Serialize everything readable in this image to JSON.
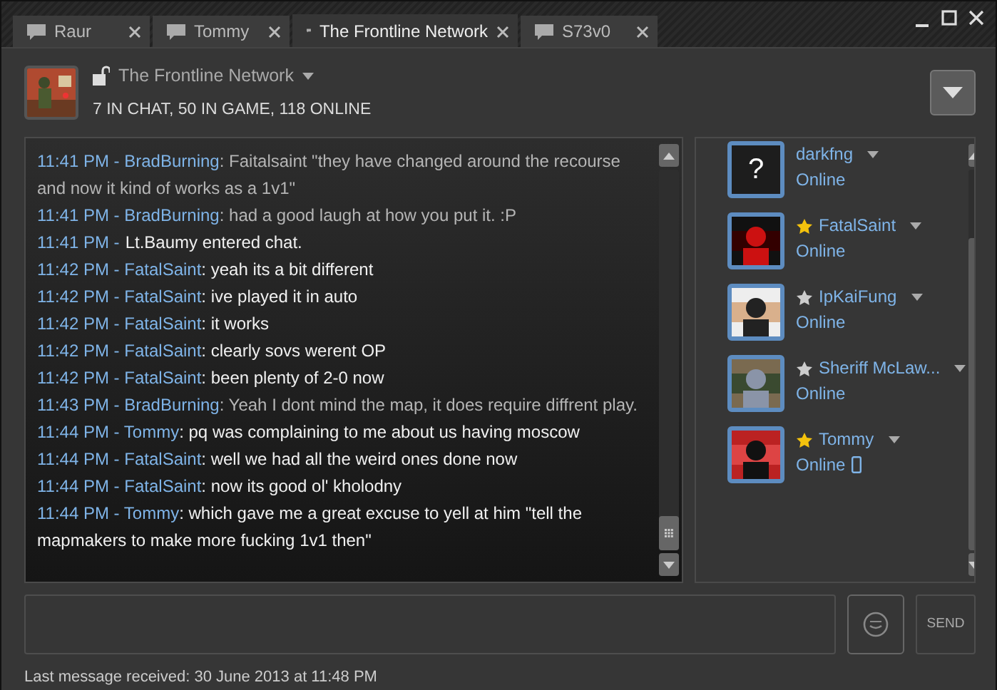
{
  "tabs": [
    {
      "label": "Raur",
      "selected": false
    },
    {
      "label": "Tommy",
      "selected": false
    },
    {
      "label": "The Frontline Network",
      "selected": true
    },
    {
      "label": "S73v0",
      "selected": false
    }
  ],
  "header": {
    "title": "The Frontline Network",
    "counts": "7 IN CHAT, 50 IN GAME, 118 ONLINE"
  },
  "messages": [
    {
      "kind": "message",
      "sender": "11:41 PM - BradBurning",
      "text": ": Faitalsaint \"they have changed around the recourse and now it kind of works as a 1v1\"",
      "dim": true
    },
    {
      "kind": "message",
      "sender": "11:41 PM - BradBurning",
      "text": ": had a good laugh at how you put it. :P",
      "dim": true
    },
    {
      "kind": "event",
      "prefix": "11:41 PM -",
      "text": "Lt.Baumy entered chat."
    },
    {
      "kind": "message",
      "sender": "11:42 PM - FatalSaint",
      "text": ": yeah its a bit different",
      "dim": false
    },
    {
      "kind": "message",
      "sender": "11:42 PM - FatalSaint",
      "text": ": ive played it in auto",
      "dim": false
    },
    {
      "kind": "message",
      "sender": "11:42 PM - FatalSaint",
      "text": ": it works",
      "dim": false
    },
    {
      "kind": "message",
      "sender": "11:42 PM - FatalSaint",
      "text": ": clearly sovs werent OP",
      "dim": false
    },
    {
      "kind": "message",
      "sender": "11:42 PM - FatalSaint",
      "text": ": been plenty of 2-0 now",
      "dim": false
    },
    {
      "kind": "message",
      "sender": "11:43 PM - BradBurning",
      "text": ": Yeah I dont mind the map, it does require diffrent play.",
      "dim": true
    },
    {
      "kind": "message",
      "sender": "11:44 PM - Tommy",
      "text": ": pq was complaining to me about us having moscow",
      "dim": false
    },
    {
      "kind": "message",
      "sender": "11:44 PM - FatalSaint",
      "text": ": well we had all the weird ones done now",
      "dim": false
    },
    {
      "kind": "message",
      "sender": "11:44 PM - FatalSaint",
      "text": ": now its good ol' kholodny",
      "dim": false
    },
    {
      "kind": "message",
      "sender": "11:44 PM - Tommy",
      "text": ": which gave me a great excuse to yell at him \"tell the mapmakers to make more fucking 1v1 then\"",
      "dim": false
    }
  ],
  "members": [
    {
      "name": "darkfng",
      "status": "Online",
      "avatar": {
        "kind": "unknown",
        "text": "?"
      },
      "mobile": false
    },
    {
      "name": "FatalSaint",
      "status": "Online",
      "starred": true,
      "mobile": false
    },
    {
      "name": "IpKaiFung",
      "status": "Online",
      "starred": false,
      "mobile": false
    },
    {
      "name": "Sheriff McLaw...",
      "status": "Online",
      "starred": false,
      "mobile": false
    },
    {
      "name": "Tommy",
      "status": "Online",
      "starred": true,
      "mobile": true
    }
  ],
  "send_button": "SEND",
  "status_bar": "Last message received: 30 June 2013 at 11:48 PM"
}
